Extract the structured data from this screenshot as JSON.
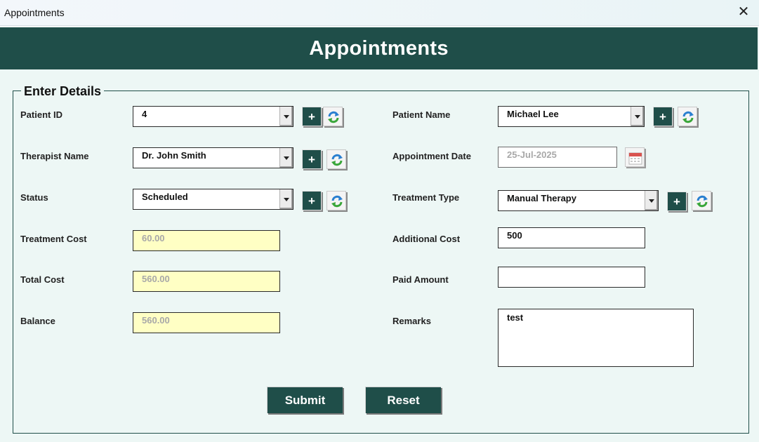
{
  "window": {
    "title": "Appointments",
    "close_glyph": "✕"
  },
  "header": {
    "title": "Appointments"
  },
  "section": {
    "caption": "Enter Details"
  },
  "left": {
    "patient_id": {
      "label": "Patient ID",
      "value": "4"
    },
    "therapist_name": {
      "label": "Therapist Name",
      "value": "Dr. John Smith"
    },
    "status": {
      "label": "Status",
      "value": "Scheduled"
    },
    "treatment_cost": {
      "label": "Treatment Cost",
      "value": "60.00"
    },
    "total_cost": {
      "label": "Total Cost",
      "value": "560.00"
    },
    "balance": {
      "label": "Balance",
      "value": "560.00"
    }
  },
  "right": {
    "patient_name": {
      "label": "Patient Name",
      "value": "Michael Lee"
    },
    "appointment_date": {
      "label": "Appointment Date",
      "value": "25-Jul-2025"
    },
    "treatment_type": {
      "label": "Treatment Type",
      "value": "Manual Therapy"
    },
    "additional_cost": {
      "label": "Additional Cost",
      "value": "500"
    },
    "paid_amount": {
      "label": "Paid Amount",
      "value": ""
    },
    "remarks": {
      "label": "Remarks",
      "value": "test"
    }
  },
  "buttons": {
    "add": "+",
    "submit": "Submit",
    "reset": "Reset"
  },
  "icons": {
    "add": "plus-icon",
    "refresh": "refresh-icon",
    "calendar": "calendar-icon",
    "dropdown": "chevron-down-icon",
    "close": "close-icon"
  },
  "colors": {
    "brand": "#1f4e49",
    "background": "#edf7f5",
    "readonly_field": "#ffffc4",
    "refresh_green": "#3aa63a",
    "refresh_blue": "#2a7fd0"
  }
}
